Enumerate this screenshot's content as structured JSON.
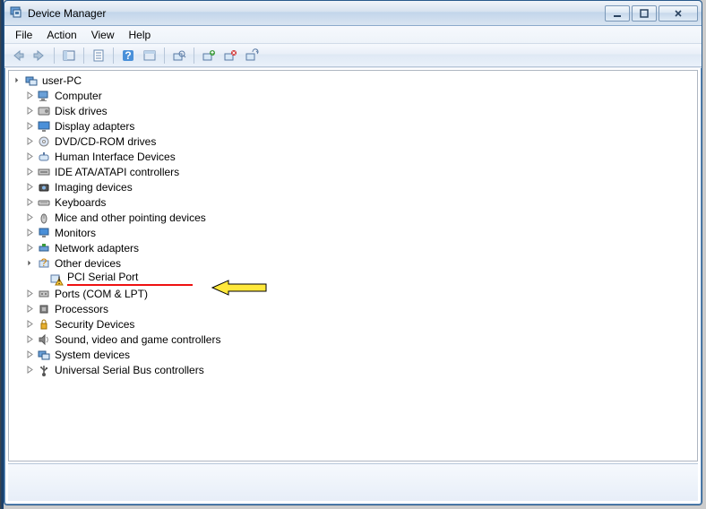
{
  "window": {
    "title": "Device Manager"
  },
  "menu": {
    "file": "File",
    "action": "Action",
    "view": "View",
    "help": "Help"
  },
  "tree": {
    "root": "user-PC",
    "categories": [
      {
        "label": "Computer",
        "icon": "computer",
        "expanded": false
      },
      {
        "label": "Disk drives",
        "icon": "disk",
        "expanded": false
      },
      {
        "label": "Display adapters",
        "icon": "display",
        "expanded": false
      },
      {
        "label": "DVD/CD-ROM drives",
        "icon": "dvd",
        "expanded": false
      },
      {
        "label": "Human Interface Devices",
        "icon": "hid",
        "expanded": false
      },
      {
        "label": "IDE ATA/ATAPI controllers",
        "icon": "ide",
        "expanded": false
      },
      {
        "label": "Imaging devices",
        "icon": "imaging",
        "expanded": false
      },
      {
        "label": "Keyboards",
        "icon": "keyboard",
        "expanded": false
      },
      {
        "label": "Mice and other pointing devices",
        "icon": "mouse",
        "expanded": false
      },
      {
        "label": "Monitors",
        "icon": "monitor",
        "expanded": false
      },
      {
        "label": "Network adapters",
        "icon": "network",
        "expanded": false
      },
      {
        "label": "Other devices",
        "icon": "other",
        "expanded": true,
        "children": [
          {
            "label": "PCI Serial Port",
            "icon": "unknown-warn",
            "highlighted": true
          }
        ]
      },
      {
        "label": "Ports (COM & LPT)",
        "icon": "ports",
        "expanded": false
      },
      {
        "label": "Processors",
        "icon": "cpu",
        "expanded": false
      },
      {
        "label": "Security Devices",
        "icon": "security",
        "expanded": false
      },
      {
        "label": "Sound, video and game controllers",
        "icon": "sound",
        "expanded": false
      },
      {
        "label": "System devices",
        "icon": "system",
        "expanded": false
      },
      {
        "label": "Universal Serial Bus controllers",
        "icon": "usb",
        "expanded": false
      }
    ]
  }
}
